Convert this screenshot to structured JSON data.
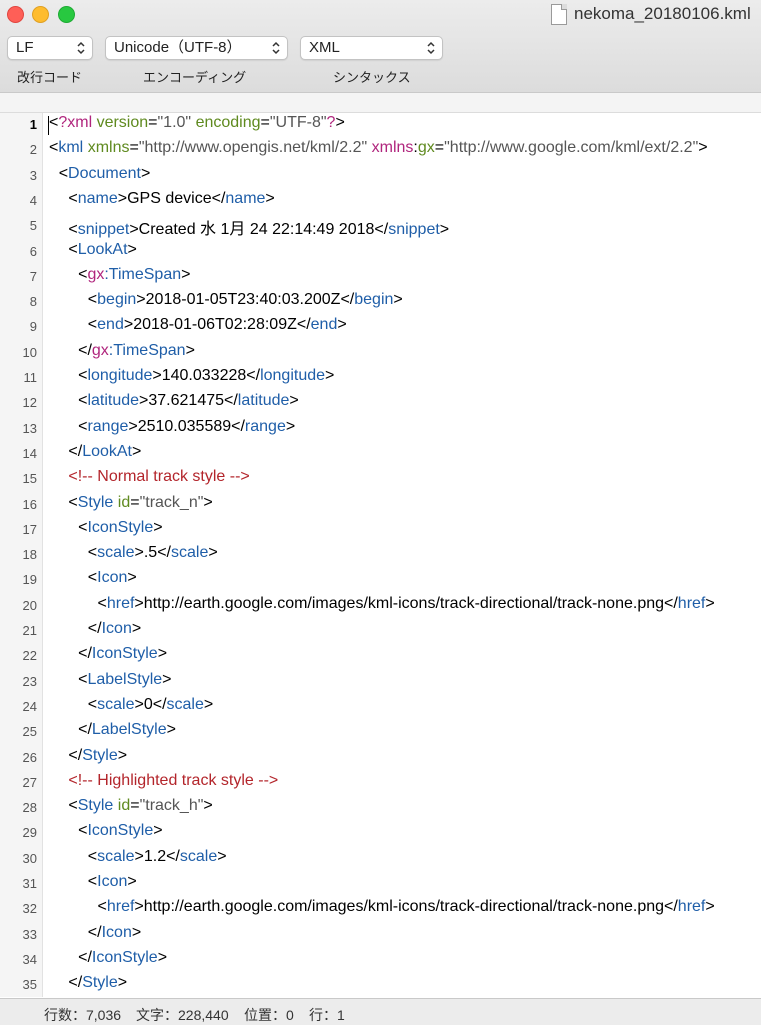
{
  "window": {
    "title": "nekoma_20180106.kml"
  },
  "toolbar": {
    "line_ending": {
      "value": "LF",
      "caption": "改行コード"
    },
    "encoding": {
      "value": "Unicode（UTF-8）",
      "caption": "エンコーディング"
    },
    "syntax": {
      "value": "XML",
      "caption": "シンタックス"
    }
  },
  "editor": {
    "current_line": 1,
    "lines": [
      {
        "n": "1",
        "indent": 0,
        "tokens": [
          [
            "p",
            "<"
          ],
          [
            "ns",
            "?xml"
          ],
          [
            "p",
            " "
          ],
          [
            "at",
            "version"
          ],
          [
            "p",
            "="
          ],
          [
            "vl",
            "\"1.0\""
          ],
          [
            "p",
            " "
          ],
          [
            "at",
            "encoding"
          ],
          [
            "p",
            "="
          ],
          [
            "vl",
            "\"UTF-8\""
          ],
          [
            "ns",
            "?"
          ],
          [
            "p",
            ">"
          ]
        ]
      },
      {
        "n": "2",
        "indent": 0,
        "tokens": [
          [
            "p",
            "<"
          ],
          [
            "tg",
            "kml"
          ],
          [
            "p",
            " "
          ],
          [
            "at",
            "xmlns"
          ],
          [
            "p",
            "="
          ],
          [
            "vl",
            "\"http://www.opengis.net/kml/2.2\""
          ],
          [
            "p",
            " "
          ],
          [
            "ns",
            "xmlns"
          ],
          [
            "p",
            ":"
          ],
          [
            "at",
            "gx"
          ],
          [
            "p",
            "="
          ],
          [
            "vl",
            "\"http://www.google.com/kml/ext/2.2\""
          ],
          [
            "p",
            ">"
          ]
        ]
      },
      {
        "n": "3",
        "indent": 1,
        "tokens": [
          [
            "p",
            "<"
          ],
          [
            "tg",
            "Document"
          ],
          [
            "p",
            ">"
          ]
        ]
      },
      {
        "n": "4",
        "indent": 2,
        "tokens": [
          [
            "p",
            "<"
          ],
          [
            "tg",
            "name"
          ],
          [
            "p",
            ">GPS device</"
          ],
          [
            "tg",
            "name"
          ],
          [
            "p",
            ">"
          ]
        ]
      },
      {
        "n": "5",
        "indent": 2,
        "tokens": [
          [
            "p",
            "<"
          ],
          [
            "tg",
            "snippet"
          ],
          [
            "p",
            ">Created 水 1月 24 22:14:49 2018</"
          ],
          [
            "tg",
            "snippet"
          ],
          [
            "p",
            ">"
          ]
        ]
      },
      {
        "n": "6",
        "indent": 2,
        "tokens": [
          [
            "p",
            "<"
          ],
          [
            "tg",
            "LookAt"
          ],
          [
            "p",
            ">"
          ]
        ]
      },
      {
        "n": "7",
        "indent": 3,
        "tokens": [
          [
            "p",
            "<"
          ],
          [
            "ns",
            "gx"
          ],
          [
            "tg",
            ":TimeSpan"
          ],
          [
            "p",
            ">"
          ]
        ]
      },
      {
        "n": "8",
        "indent": 4,
        "tokens": [
          [
            "p",
            "<"
          ],
          [
            "tg",
            "begin"
          ],
          [
            "p",
            ">2018-01-05T23:40:03.200Z</"
          ],
          [
            "tg",
            "begin"
          ],
          [
            "p",
            ">"
          ]
        ]
      },
      {
        "n": "9",
        "indent": 4,
        "tokens": [
          [
            "p",
            "<"
          ],
          [
            "tg",
            "end"
          ],
          [
            "p",
            ">2018-01-06T02:28:09Z</"
          ],
          [
            "tg",
            "end"
          ],
          [
            "p",
            ">"
          ]
        ]
      },
      {
        "n": "10",
        "indent": 3,
        "tokens": [
          [
            "p",
            "</"
          ],
          [
            "ns",
            "gx"
          ],
          [
            "tg",
            ":TimeSpan"
          ],
          [
            "p",
            ">"
          ]
        ]
      },
      {
        "n": "11",
        "indent": 3,
        "tokens": [
          [
            "p",
            "<"
          ],
          [
            "tg",
            "longitude"
          ],
          [
            "p",
            ">140.033228</"
          ],
          [
            "tg",
            "longitude"
          ],
          [
            "p",
            ">"
          ]
        ]
      },
      {
        "n": "12",
        "indent": 3,
        "tokens": [
          [
            "p",
            "<"
          ],
          [
            "tg",
            "latitude"
          ],
          [
            "p",
            ">37.621475</"
          ],
          [
            "tg",
            "latitude"
          ],
          [
            "p",
            ">"
          ]
        ]
      },
      {
        "n": "13",
        "indent": 3,
        "tokens": [
          [
            "p",
            "<"
          ],
          [
            "tg",
            "range"
          ],
          [
            "p",
            ">2510.035589</"
          ],
          [
            "tg",
            "range"
          ],
          [
            "p",
            ">"
          ]
        ]
      },
      {
        "n": "14",
        "indent": 2,
        "tokens": [
          [
            "p",
            "</"
          ],
          [
            "tg",
            "LookAt"
          ],
          [
            "p",
            ">"
          ]
        ]
      },
      {
        "n": "15",
        "indent": 2,
        "tokens": [
          [
            "cm",
            "<!-- Normal track style -->"
          ]
        ]
      },
      {
        "n": "16",
        "indent": 2,
        "tokens": [
          [
            "p",
            "<"
          ],
          [
            "tg",
            "Style"
          ],
          [
            "p",
            " "
          ],
          [
            "at",
            "id"
          ],
          [
            "p",
            "="
          ],
          [
            "vl",
            "\"track_n\""
          ],
          [
            "p",
            ">"
          ]
        ]
      },
      {
        "n": "17",
        "indent": 3,
        "tokens": [
          [
            "p",
            "<"
          ],
          [
            "tg",
            "IconStyle"
          ],
          [
            "p",
            ">"
          ]
        ]
      },
      {
        "n": "18",
        "indent": 4,
        "tokens": [
          [
            "p",
            "<"
          ],
          [
            "tg",
            "scale"
          ],
          [
            "p",
            ">.5</"
          ],
          [
            "tg",
            "scale"
          ],
          [
            "p",
            ">"
          ]
        ]
      },
      {
        "n": "19",
        "indent": 4,
        "tokens": [
          [
            "p",
            "<"
          ],
          [
            "tg",
            "Icon"
          ],
          [
            "p",
            ">"
          ]
        ]
      },
      {
        "n": "20",
        "indent": 5,
        "tokens": [
          [
            "p",
            "<"
          ],
          [
            "tg",
            "href"
          ],
          [
            "p",
            ">http://earth.google.com/images/kml-icons/track-directional/track-none.png</"
          ],
          [
            "tg",
            "href"
          ],
          [
            "p",
            ">"
          ]
        ]
      },
      {
        "n": "21",
        "indent": 4,
        "tokens": [
          [
            "p",
            "</"
          ],
          [
            "tg",
            "Icon"
          ],
          [
            "p",
            ">"
          ]
        ]
      },
      {
        "n": "22",
        "indent": 3,
        "tokens": [
          [
            "p",
            "</"
          ],
          [
            "tg",
            "IconStyle"
          ],
          [
            "p",
            ">"
          ]
        ]
      },
      {
        "n": "23",
        "indent": 3,
        "tokens": [
          [
            "p",
            "<"
          ],
          [
            "tg",
            "LabelStyle"
          ],
          [
            "p",
            ">"
          ]
        ]
      },
      {
        "n": "24",
        "indent": 4,
        "tokens": [
          [
            "p",
            "<"
          ],
          [
            "tg",
            "scale"
          ],
          [
            "p",
            ">0</"
          ],
          [
            "tg",
            "scale"
          ],
          [
            "p",
            ">"
          ]
        ]
      },
      {
        "n": "25",
        "indent": 3,
        "tokens": [
          [
            "p",
            "</"
          ],
          [
            "tg",
            "LabelStyle"
          ],
          [
            "p",
            ">"
          ]
        ]
      },
      {
        "n": "26",
        "indent": 2,
        "tokens": [
          [
            "p",
            "</"
          ],
          [
            "tg",
            "Style"
          ],
          [
            "p",
            ">"
          ]
        ]
      },
      {
        "n": "27",
        "indent": 2,
        "tokens": [
          [
            "cm",
            "<!-- Highlighted track style -->"
          ]
        ]
      },
      {
        "n": "28",
        "indent": 2,
        "tokens": [
          [
            "p",
            "<"
          ],
          [
            "tg",
            "Style"
          ],
          [
            "p",
            " "
          ],
          [
            "at",
            "id"
          ],
          [
            "p",
            "="
          ],
          [
            "vl",
            "\"track_h\""
          ],
          [
            "p",
            ">"
          ]
        ]
      },
      {
        "n": "29",
        "indent": 3,
        "tokens": [
          [
            "p",
            "<"
          ],
          [
            "tg",
            "IconStyle"
          ],
          [
            "p",
            ">"
          ]
        ]
      },
      {
        "n": "30",
        "indent": 4,
        "tokens": [
          [
            "p",
            "<"
          ],
          [
            "tg",
            "scale"
          ],
          [
            "p",
            ">1.2</"
          ],
          [
            "tg",
            "scale"
          ],
          [
            "p",
            ">"
          ]
        ]
      },
      {
        "n": "31",
        "indent": 4,
        "tokens": [
          [
            "p",
            "<"
          ],
          [
            "tg",
            "Icon"
          ],
          [
            "p",
            ">"
          ]
        ]
      },
      {
        "n": "32",
        "indent": 5,
        "tokens": [
          [
            "p",
            "<"
          ],
          [
            "tg",
            "href"
          ],
          [
            "p",
            ">http://earth.google.com/images/kml-icons/track-directional/track-none.png</"
          ],
          [
            "tg",
            "href"
          ],
          [
            "p",
            ">"
          ]
        ]
      },
      {
        "n": "33",
        "indent": 4,
        "tokens": [
          [
            "p",
            "</"
          ],
          [
            "tg",
            "Icon"
          ],
          [
            "p",
            ">"
          ]
        ]
      },
      {
        "n": "34",
        "indent": 3,
        "tokens": [
          [
            "p",
            "</"
          ],
          [
            "tg",
            "IconStyle"
          ],
          [
            "p",
            ">"
          ]
        ]
      },
      {
        "n": "35",
        "indent": 2,
        "tokens": [
          [
            "p",
            "</"
          ],
          [
            "tg",
            "Style"
          ],
          [
            "p",
            ">"
          ]
        ]
      }
    ]
  },
  "status": {
    "lines": "行数：7,036",
    "chars": "文字：228,440",
    "position": "位置：0",
    "row": "行：1"
  },
  "colors": {
    "tag": "#1f5ea8",
    "namespace": "#b0257d",
    "attribute": "#5f8a1f",
    "value": "#555555",
    "comment": "#b3252b"
  }
}
